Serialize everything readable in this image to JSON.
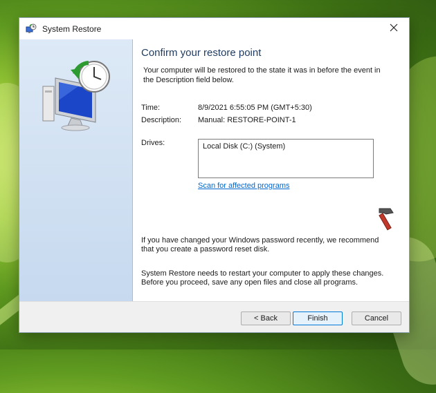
{
  "window": {
    "title": "System Restore"
  },
  "content": {
    "heading": "Confirm your restore point",
    "intro": "Your computer will be restored to the state it was in before the event in the Description field below.",
    "time_label": "Time:",
    "time_value": "8/9/2021 6:55:05 PM (GMT+5:30)",
    "description_label": "Description:",
    "description_value": "Manual: RESTORE-POINT-1",
    "drives_label": "Drives:",
    "drives": [
      "Local Disk (C:) (System)"
    ],
    "scan_link": "Scan for affected programs",
    "password_note": "If you have changed your Windows password recently, we recommend that you create a password reset disk.",
    "restart_note": "System Restore needs to restart your computer to apply these changes. Before you proceed, save any open files and close all programs."
  },
  "buttons": {
    "back": "< Back",
    "finish": "Finish",
    "cancel": "Cancel"
  },
  "icons": {
    "app": "system-restore-icon",
    "hero": "monitor-clock-restore-icon",
    "tool": "hammer-icon",
    "close": "close-icon"
  },
  "colors": {
    "link": "#0066cc",
    "heading": "#1e3a5f",
    "sidebar": "#d4e3f3",
    "default_button_border": "#0078d7"
  }
}
